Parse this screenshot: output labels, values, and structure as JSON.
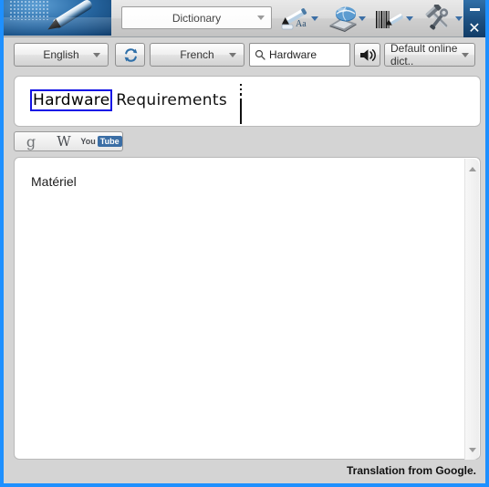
{
  "app": {
    "logo_icon": "pen-logo-icon",
    "mode": {
      "label": "Dictionary",
      "caret_icon": "chevron-down-icon"
    }
  },
  "titlebar_tools": [
    {
      "id": "text-recognition",
      "label": "Aa",
      "icon": "pen-text-icon",
      "caret_icon": "chevron-down-icon"
    },
    {
      "id": "scan-to-app",
      "label": "",
      "icon": "scanner-globe-icon",
      "caret_icon": "chevron-down-icon"
    },
    {
      "id": "barcode-scan",
      "label": "",
      "icon": "barcode-pen-icon",
      "caret_icon": "chevron-down-icon"
    },
    {
      "id": "settings-tools",
      "label": "",
      "icon": "hammer-wrench-icon",
      "caret_icon": "chevron-down-icon"
    }
  ],
  "window_controls": {
    "minimize_icon": "minimize-icon",
    "close_label": "✕",
    "close_icon": "close-icon"
  },
  "toolbar": {
    "source_language": "English",
    "target_language": "French",
    "swap_icon": "swap-arrows-icon",
    "search": {
      "value": "Hardware",
      "placeholder": "Search",
      "icon": "search-icon"
    },
    "speak_icon": "speaker-icon",
    "dictionary": {
      "label": "Default online dict..",
      "caret_icon": "chevron-down-icon"
    }
  },
  "scan_panel": {
    "selected_word": "Hardware",
    "rest_text": " Requirements",
    "artifact_icon": "scan-line-artifact"
  },
  "web_search": {
    "google_label": "g",
    "google_icon": "google-icon",
    "wikipedia_label": "W",
    "wikipedia_icon": "wikipedia-icon",
    "youtube_you": "You",
    "youtube_tube": "Tube",
    "youtube_icon": "youtube-icon"
  },
  "result": {
    "translation": "Matériel",
    "scroll_up_icon": "scroll-up-arrow-icon",
    "scroll_down_icon": "scroll-down-arrow-icon"
  },
  "status": {
    "text": "Translation from Google."
  },
  "colors": {
    "window_border": "#1e90ff",
    "chrome": "#d4d4d4",
    "titlebar_accent": "#1c4f80",
    "selection_outline": "#1414e6",
    "youtube_badge": "#3b6ea5"
  }
}
